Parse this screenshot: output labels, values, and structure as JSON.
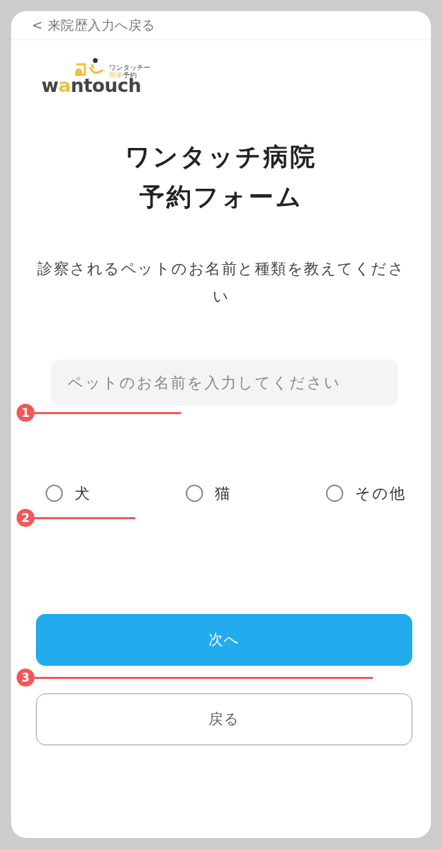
{
  "back_link": {
    "label": "< 来院歴入力へ戻る"
  },
  "logo": {
    "tagline_lines": [
      [
        {
          "text": "ワンタッチー",
          "accent": false
        }
      ],
      [
        {
          "text": "簡単",
          "accent": true
        },
        {
          "text": "予約",
          "accent": false
        }
      ]
    ],
    "wordmark": [
      {
        "text": "w",
        "accent": false
      },
      {
        "text": "a",
        "accent": true
      },
      {
        "text": "ntouch",
        "accent": false
      }
    ]
  },
  "title_lines": [
    "ワンタッチ病院",
    "予約フォーム"
  ],
  "instruction": "診察されるペットのお名前と種類を教えてください",
  "pet_name_field": {
    "placeholder": "ペットのお名前を入力してください",
    "marker": "1"
  },
  "pet_type": {
    "options": [
      {
        "label": "犬",
        "selected": false
      },
      {
        "label": "猫",
        "selected": false
      },
      {
        "label": "その他",
        "selected": false
      }
    ],
    "marker": "2"
  },
  "buttons": [
    {
      "kind": "primary",
      "label": "次へ",
      "marker": "3"
    },
    {
      "kind": "secondary",
      "label": "戻る"
    }
  ]
}
